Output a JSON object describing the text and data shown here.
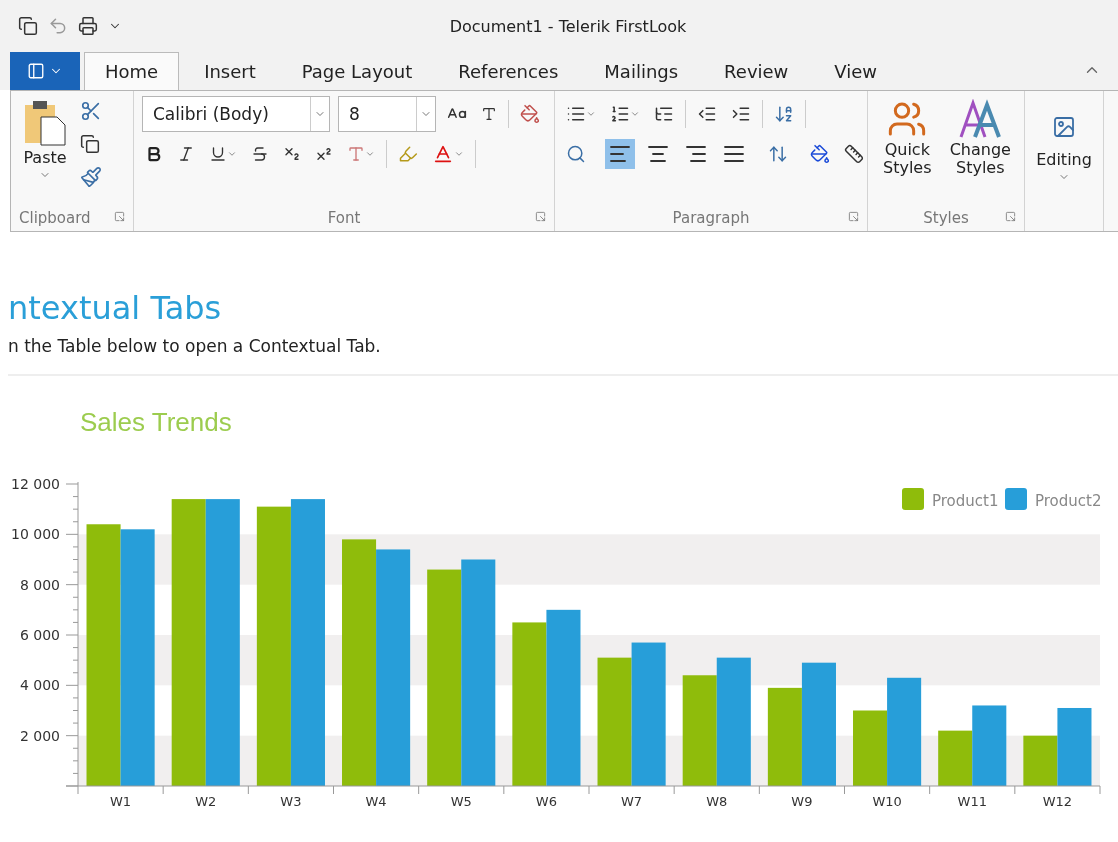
{
  "window": {
    "title": "Document1 - Telerik FirstLook"
  },
  "tabs": [
    {
      "label": "Home",
      "selected": true
    },
    {
      "label": "Insert",
      "selected": false
    },
    {
      "label": "Page Layout",
      "selected": false
    },
    {
      "label": "References",
      "selected": false
    },
    {
      "label": "Mailings",
      "selected": false
    },
    {
      "label": "Review",
      "selected": false
    },
    {
      "label": "View",
      "selected": false
    }
  ],
  "ribbon": {
    "clipboard": {
      "label": "Clipboard",
      "paste": "Paste"
    },
    "font": {
      "label": "Font",
      "font_name": "Calibri (Body)",
      "font_size": "8"
    },
    "paragraph": {
      "label": "Paragraph",
      "alignment": [
        {
          "selected": true
        },
        {
          "selected": false
        },
        {
          "selected": false
        },
        {
          "selected": false
        }
      ]
    },
    "styles": {
      "label": "Styles",
      "quick_styles": "Quick Styles",
      "change_styles": "Change Styles"
    },
    "editing": {
      "label": "Editing"
    }
  },
  "document": {
    "heading": "ntextual Tabs",
    "text": "n the Table below to open a Contextual Tab."
  },
  "chart": {
    "chart_data": {
      "type": "bar",
      "title": "Sales Trends",
      "legend": true,
      "categories": [
        "W1",
        "W2",
        "W3",
        "W4",
        "W5",
        "W6",
        "W7",
        "W8",
        "W9",
        "W10",
        "W11",
        "W12"
      ],
      "series": [
        {
          "name": "Product1",
          "color": "#8fbc0b",
          "values": [
            10400,
            11400,
            11100,
            9800,
            8600,
            6500,
            5100,
            4400,
            3900,
            3000,
            2200,
            2000
          ]
        },
        {
          "name": "Product2",
          "color": "#279ed9",
          "values": [
            10200,
            11400,
            11400,
            9400,
            9000,
            7000,
            5700,
            5100,
            4900,
            4300,
            3200,
            3100
          ]
        }
      ],
      "ylim": [
        0,
        12000
      ],
      "yticks": [
        {
          "value": 2000,
          "label": "2 000"
        },
        {
          "value": 4000,
          "label": "4 000"
        },
        {
          "value": 6000,
          "label": "6 000"
        },
        {
          "value": 8000,
          "label": "8 000"
        },
        {
          "value": 10000,
          "label": "10 000"
        },
        {
          "value": 12000,
          "label": "12 000"
        }
      ]
    }
  }
}
